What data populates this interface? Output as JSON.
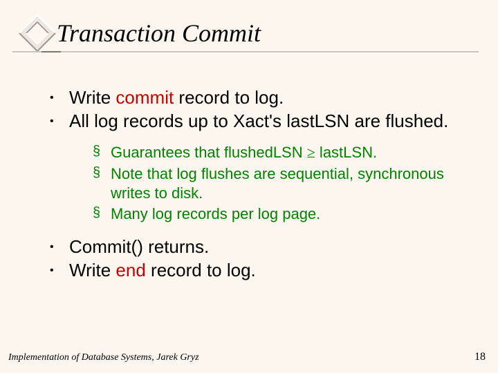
{
  "title": "Transaction Commit",
  "bullets": {
    "b1_pre": "Write ",
    "b1_red": "commit",
    "b1_post": " record to log.",
    "b2": "All log records up to Xact's lastLSN are flushed.",
    "s1_pre": "Guarantees that flushedLSN ",
    "s1_sym": "≥",
    "s1_post": " lastLSN.",
    "s2": "Note that log flushes are sequential, synchronous writes to disk.",
    "s3": "Many log records per log page.",
    "b3": "Commit() returns.",
    "b4_pre": "Write ",
    "b4_red": "end",
    "b4_post": " record to log."
  },
  "footer": {
    "left": "Implementation of Database Systems, Jarek Gryz",
    "right": "18"
  }
}
